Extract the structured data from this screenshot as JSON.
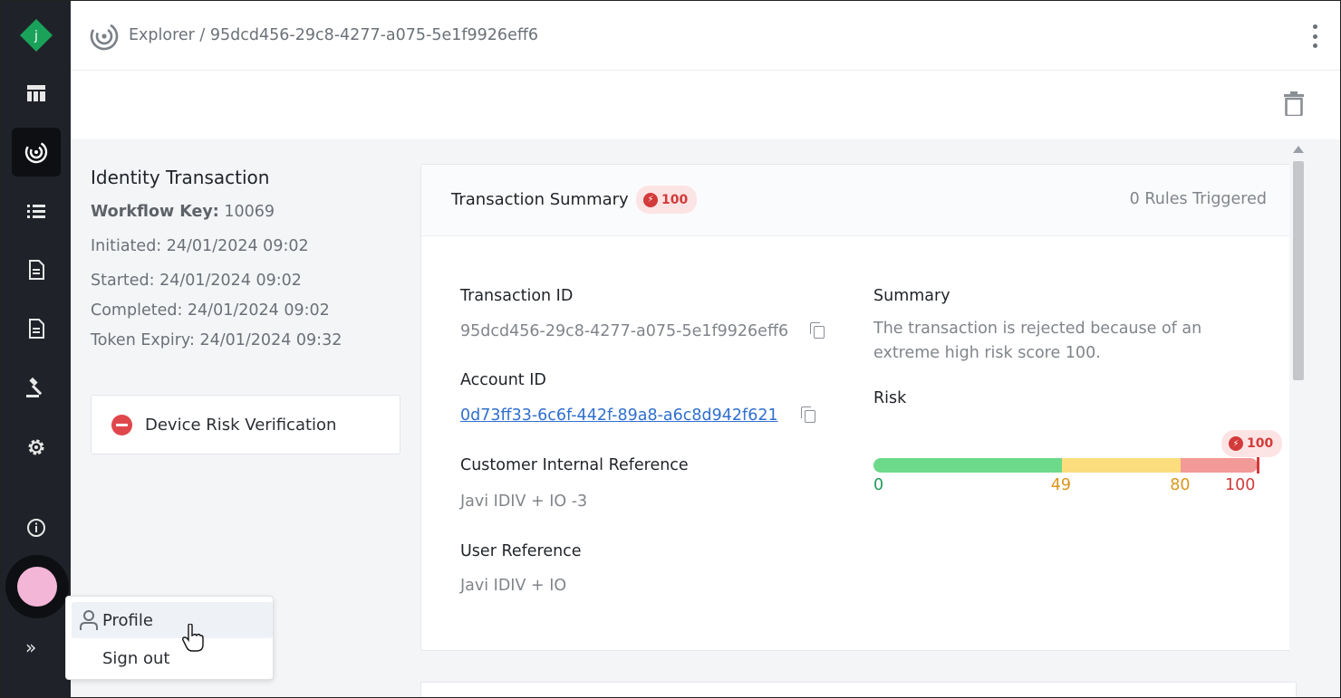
{
  "app": {
    "logo_letter": "j",
    "brand_color": "#1aa25a"
  },
  "header": {
    "breadcrumb": "Explorer / 95dcd456-29c8-4277-a075-5e1f9926eff6",
    "breadcrumb_icon": "radar-icon",
    "menu_icon": "kebab-menu-icon"
  },
  "toolbar": {
    "delete_icon": "trash-icon"
  },
  "sidebar": {
    "items": [
      {
        "name": "dashboard-icon",
        "active": false
      },
      {
        "name": "radar-icon",
        "active": true
      },
      {
        "name": "list-icon",
        "active": false
      },
      {
        "name": "document-icon",
        "active": false
      },
      {
        "name": "document-icon",
        "active": false
      },
      {
        "name": "gavel-icon",
        "active": false
      },
      {
        "name": "gear-icon",
        "active": false
      },
      {
        "name": "info-icon",
        "active": false
      }
    ],
    "expand_label": "»"
  },
  "transaction": {
    "title": "Identity Transaction",
    "workflow_key_label": "Workflow Key:",
    "workflow_key_value": "10069",
    "initiated": "Initiated: 24/01/2024 09:02",
    "started": "Started: 24/01/2024 09:02",
    "completed": "Completed: 24/01/2024 09:02",
    "token_expiry": "Token Expiry: 24/01/2024 09:32",
    "verification_label": "Device Risk Verification"
  },
  "summary_card": {
    "title": "Transaction Summary",
    "score_badge": "100",
    "rules_triggered": "0 Rules Triggered",
    "transaction_id_label": "Transaction ID",
    "transaction_id": "95dcd456-29c8-4277-a075-5e1f9926eff6",
    "account_id_label": "Account ID",
    "account_id": "0d73ff33-6c6f-442f-89a8-a6c8d942f621",
    "customer_ref_label": "Customer Internal Reference",
    "customer_ref": "Javi IDIV + IO -3",
    "user_ref_label": "User Reference",
    "user_ref": "Javi IDIV + IO",
    "summary_label": "Summary",
    "summary_text": "The transaction is rejected because of an extreme high risk score 100.",
    "risk_label": "Risk",
    "risk_score": 100,
    "risk_badge": "100",
    "risk_ticks": [
      "0",
      "49",
      "80",
      "100"
    ],
    "risk_colors": {
      "low": "#6dd98a",
      "medium": "#fbdd7e",
      "high": "#f29a98"
    },
    "tick_colors": {
      "low": "#1f9a57",
      "medium": "#d9961b",
      "high": "#d33a3a"
    }
  },
  "user_menu": {
    "items": [
      {
        "label": "Profile",
        "icon": "person-icon"
      },
      {
        "label": "Sign out"
      }
    ]
  }
}
